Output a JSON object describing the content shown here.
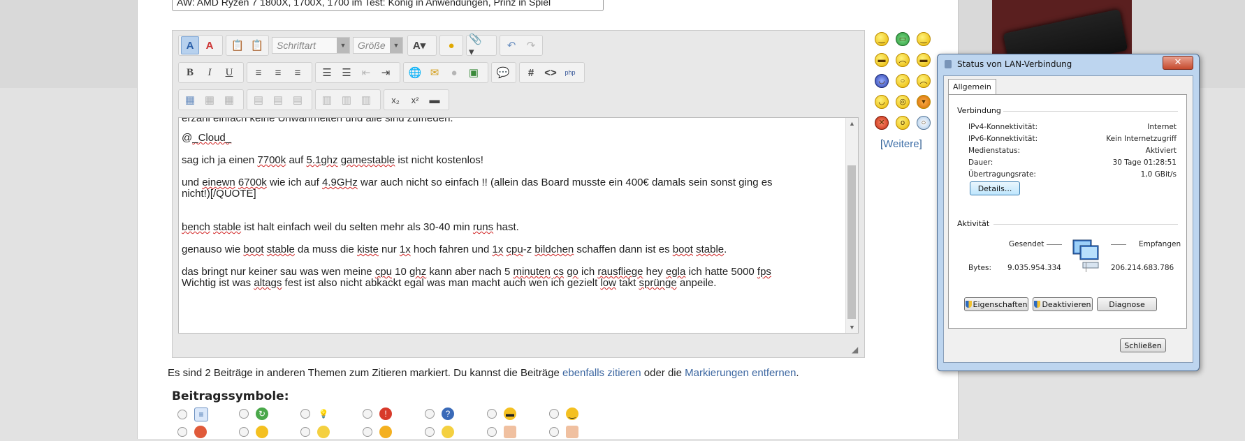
{
  "subject": {
    "value": "AW: AMD Ryzen 7 1800X, 1700X, 1700 im Test: König in Anwendungen, Prinz in Spiel"
  },
  "toolbar": {
    "font_label": "Schriftart",
    "size_label": "Größe"
  },
  "editor": {
    "lines": [
      {
        "segments": [
          {
            "t": "erzähl einfach keine Unwahrheiten und alle sind zufrieden."
          }
        ]
      },
      {
        "segments": [
          {
            "t": "@"
          },
          {
            "t": "_Cloud_",
            "u": true
          }
        ]
      },
      {
        "segments": [
          {
            "t": "sag ich ja einen "
          },
          {
            "t": "7700k",
            "u": true
          },
          {
            "t": " auf "
          },
          {
            "t": "5.1ghz",
            "u": true
          },
          {
            "t": " "
          },
          {
            "t": "gamestable",
            "u": true
          },
          {
            "t": " ist nicht kostenlos!"
          }
        ]
      },
      {
        "segments": [
          {
            "t": "und "
          },
          {
            "t": "einewn",
            "u": true
          },
          {
            "t": " "
          },
          {
            "t": "6700k",
            "u": true
          },
          {
            "t": " wie ich auf "
          },
          {
            "t": "4.9GHz",
            "u": true
          },
          {
            "t": " war auch nicht so einfach !! (allein das Board musste ein 400€ damals sein sonst ging es"
          }
        ]
      },
      {
        "segments": [
          {
            "t": "nicht!)[/QUOTE]"
          }
        ]
      },
      {
        "segments": [
          {
            "t": "bench",
            "u": true
          },
          {
            "t": " "
          },
          {
            "t": "stable",
            "u": true
          },
          {
            "t": " ist halt einfach weil du selten mehr als 30-40 min "
          },
          {
            "t": "runs",
            "u": true
          },
          {
            "t": " hast."
          }
        ]
      },
      {
        "segments": [
          {
            "t": "genauso wie "
          },
          {
            "t": "boot",
            "u": true
          },
          {
            "t": " "
          },
          {
            "t": "stable",
            "u": true
          },
          {
            "t": "  da muss die "
          },
          {
            "t": "kiste",
            "u": true
          },
          {
            "t": " nur "
          },
          {
            "t": "1x",
            "u": true
          },
          {
            "t": " hoch fahren und "
          },
          {
            "t": "1x",
            "u": true
          },
          {
            "t": " "
          },
          {
            "t": "cpu",
            "u": true
          },
          {
            "t": "-z "
          },
          {
            "t": "bildchen",
            "u": true
          },
          {
            "t": " schaffen dann ist es "
          },
          {
            "t": "boot",
            "u": true
          },
          {
            "t": " "
          },
          {
            "t": "stable",
            "u": true
          },
          {
            "t": "."
          }
        ]
      },
      {
        "segments": [
          {
            "t": "das bringt nur keiner sau was wen meine "
          },
          {
            "t": "cpu",
            "u": true
          },
          {
            "t": " 10 "
          },
          {
            "t": "ghz",
            "u": true
          },
          {
            "t": " kann aber nach 5 "
          },
          {
            "t": "minuten",
            "u": true
          },
          {
            "t": " "
          },
          {
            "t": "cs",
            "u": true
          },
          {
            "t": " "
          },
          {
            "t": "go",
            "u": true
          },
          {
            "t": " ich "
          },
          {
            "t": "rausfliege",
            "u": true
          },
          {
            "t": " hey "
          },
          {
            "t": "egla",
            "u": true
          },
          {
            "t": " ich hatte 5000 "
          },
          {
            "t": "fps",
            "u": true
          }
        ]
      },
      {
        "segments": [
          {
            "t": "Wichtig ist was "
          },
          {
            "t": "altags",
            "u": true
          },
          {
            "t": " fest ist also nicht abkackt egal was man macht auch wen ich gezielt "
          },
          {
            "t": "low",
            "u": true
          },
          {
            "t": " takt "
          },
          {
            "t": "sprünge",
            "u": true
          },
          {
            "t": " anpeile."
          }
        ]
      }
    ]
  },
  "smilies": {
    "more_prefix": "[",
    "more_label": "Weitere",
    "more_suffix": "]"
  },
  "notice": {
    "text1": "Es sind 2 Beiträge in anderen Themen zum Zitieren markiert. Du kannst die Beiträge ",
    "link1": "ebenfalls zitieren",
    "text2": " oder die ",
    "link2": "Markierungen entfernen",
    "text3": "."
  },
  "post_icons": {
    "heading": "Beitragssymbole:"
  },
  "dialog": {
    "title": "Status von LAN-Verbindung",
    "close": "✕",
    "tab": "Allgemein",
    "connection_heading": "Verbindung",
    "rows": [
      {
        "label": "IPv4-Konnektivität:",
        "value": "Internet"
      },
      {
        "label": "IPv6-Konnektivität:",
        "value": "Kein Internetzugriff"
      },
      {
        "label": "Medienstatus:",
        "value": "Aktiviert"
      },
      {
        "label": "Dauer:",
        "value": "30 Tage 01:28:51"
      },
      {
        "label": "Übertragungsrate:",
        "value": "1,0 GBit/s"
      }
    ],
    "details_button": "Details...",
    "activity_heading": "Aktivität",
    "sent_label": "Gesendet",
    "received_label": "Empfangen",
    "bytes_label": "Bytes:",
    "bytes_sent": "9.035.954.334",
    "bytes_received": "206.214.683.786",
    "properties_button": "Eigenschaften",
    "deactivate_button": "Deaktivieren",
    "diagnose_button": "Diagnose",
    "close_button": "Schließen"
  }
}
